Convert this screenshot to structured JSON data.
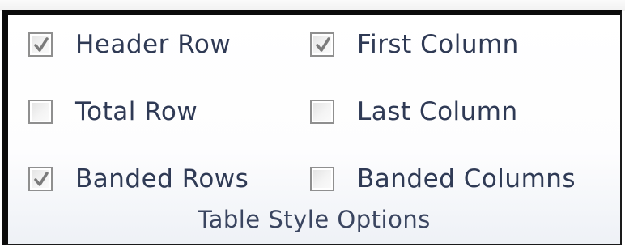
{
  "group_label": "Table Style Options",
  "options": {
    "header_row": {
      "label": "Header Row",
      "checked": true
    },
    "first_column": {
      "label": "First Column",
      "checked": true
    },
    "total_row": {
      "label": "Total Row",
      "checked": false
    },
    "last_column": {
      "label": "Last Column",
      "checked": false
    },
    "banded_rows": {
      "label": "Banded Rows",
      "checked": true
    },
    "banded_columns": {
      "label": "Banded Columns",
      "checked": false
    }
  },
  "colors": {
    "label_text": "#2f3a55",
    "checkbox_border": "#8f8f8f",
    "checkmark": "#7b7b7b",
    "panel_border": "#0b0b0b"
  },
  "icons": {
    "checked": "checkmark-icon"
  }
}
